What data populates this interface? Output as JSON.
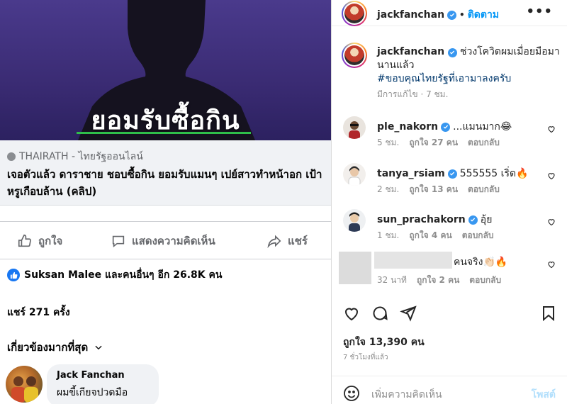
{
  "facebook": {
    "hero_text": "ยอมรับซื้อกิน",
    "link_source": "THAIRATH - ไทยรัฐออนไลน์",
    "link_title": "เจอตัวแล้ว ดาราชาย ชอบซื้อกิน ยอมรับแมนๆ เปย์สาวทำหน้าอก เป้าหรูเกือบล้าน (คลิป)",
    "like_label": "ถูกใจ",
    "comment_label": "แสดงความคิดเห็น",
    "share_label": "แชร์",
    "reactions_text": "Suksan Malee และคนอื่นๆ อีก 26.8K คน",
    "shares_text": "แชร์ 271 ครั้ง",
    "relevant_label": "เกี่ยวข้องมากที่สุด",
    "comment": {
      "name": "Jack Fanchan",
      "text": "ผมขี้เกียจปวดมือ"
    }
  },
  "instagram": {
    "header": {
      "username": "jackfanchan",
      "dot": "•",
      "follow_label": "ติดตาม",
      "more": "•••"
    },
    "caption": {
      "username": "jackfanchan",
      "text": "ช่วงโควิดผมเมื่อยมือมานานแล้ว",
      "hashtag": "#ขอบคุณไทยรัฐที่เอามาลงครับ",
      "edited": "มีการแก้ไข",
      "time": "· 7 ชม."
    },
    "comments": [
      {
        "username": "ple_nakorn",
        "text": "...แมนมาก😂",
        "time": "5 ชม.",
        "likes": "ถูกใจ 27 คน",
        "reply": "ตอบกลับ"
      },
      {
        "username": "tanya_rsiam",
        "text": "555555 เริ่ด🔥",
        "time": "2 ชม.",
        "likes": "ถูกใจ 13 คน",
        "reply": "ตอบกลับ"
      },
      {
        "username": "sun_prachakorn",
        "text": "อุ้ย",
        "time": "1 ชม.",
        "likes": "ถูกใจ 4 คน",
        "reply": "ตอบกลับ"
      },
      {
        "username": "",
        "text": "คนจริง👏🏻🔥",
        "time": "32 นาที",
        "likes": "ถูกใจ 2 คน",
        "reply": "ตอบกลับ"
      }
    ],
    "likes_text": "ถูกใจ 13,390 คน",
    "time_ago": "7 ชั่วโมงที่แล้ว",
    "add_comment_placeholder": "เพิ่มความคิดเห็น",
    "post_label": "โพสต์"
  }
}
